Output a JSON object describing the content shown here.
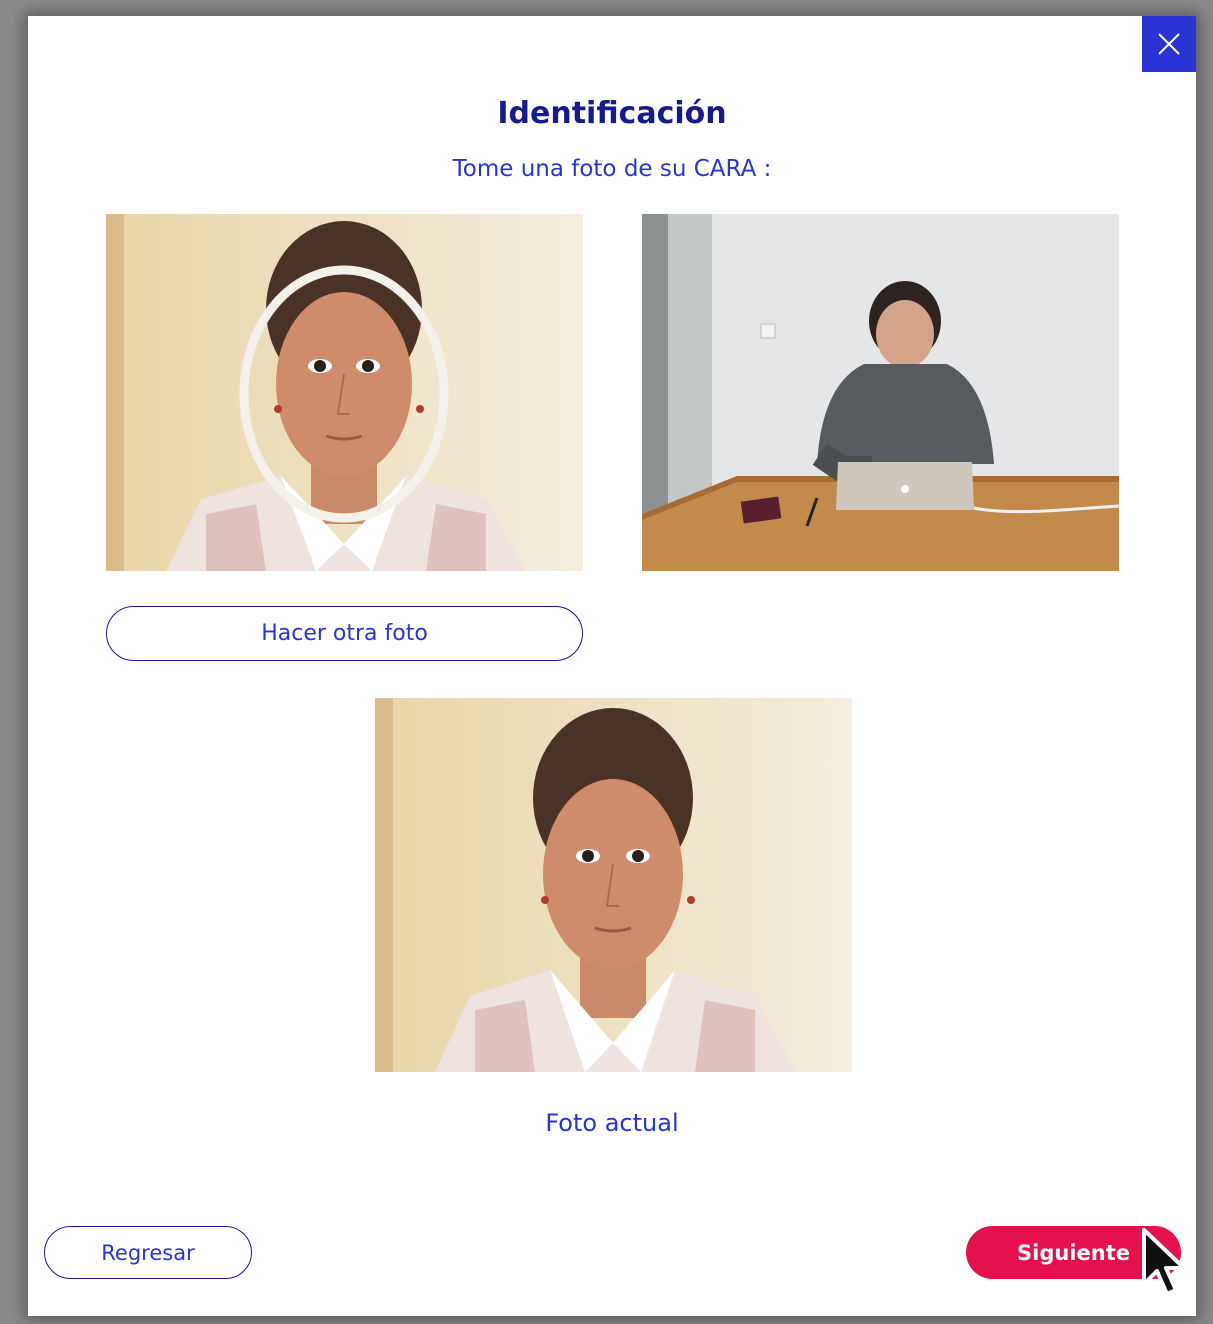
{
  "modal": {
    "title": "Identificación",
    "subtitle": "Tome una foto de su CARA :",
    "retake_label": "Hacer otra foto",
    "current_photo_caption": "Foto actual",
    "back_label": "Regresar",
    "next_label": "Siguiente",
    "close_icon": "close-icon"
  },
  "colors": {
    "accent": "#2a34d4",
    "title": "#161a8c",
    "primary_button": "#e5114f"
  }
}
